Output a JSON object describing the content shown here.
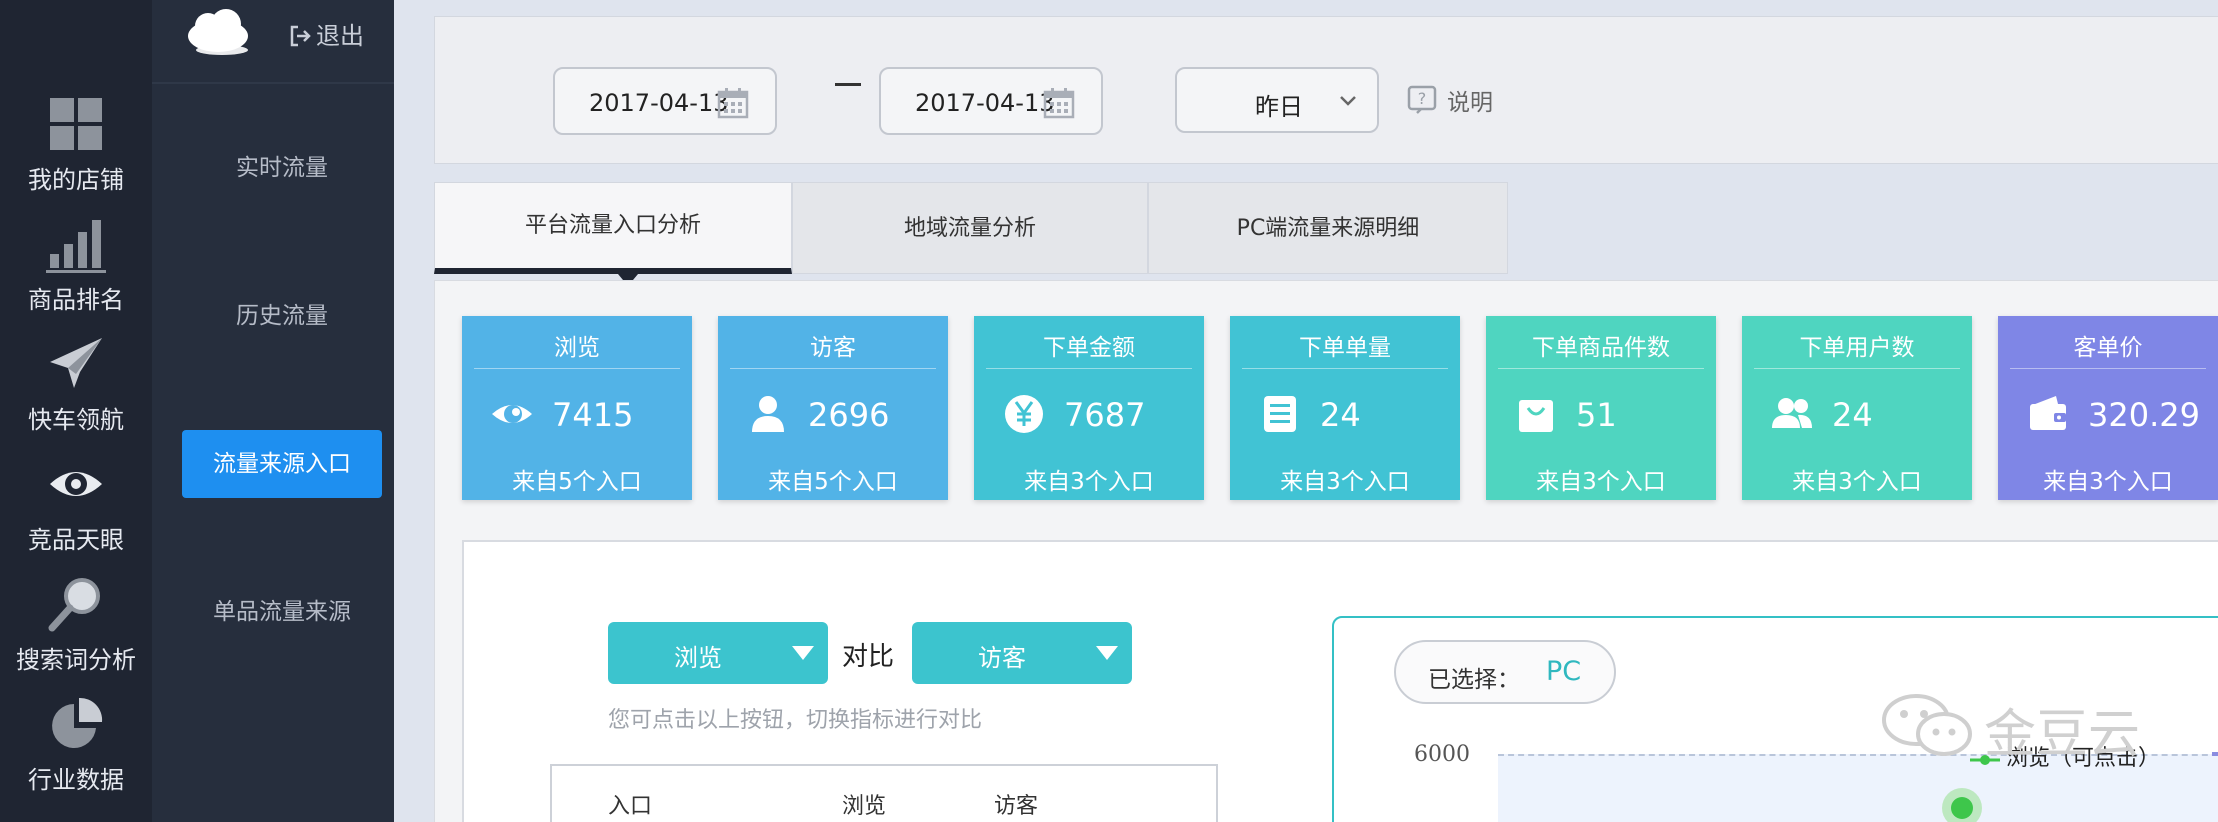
{
  "rail": {
    "items": [
      {
        "label": "我的店铺",
        "icon": "grid-icon"
      },
      {
        "label": "商品排名",
        "icon": "bar-chart-icon"
      },
      {
        "label": "快车领航",
        "icon": "paper-plane-icon"
      },
      {
        "label": "竞品天眼",
        "icon": "eye-icon"
      },
      {
        "label": "搜索词分析",
        "icon": "magnifier-icon"
      },
      {
        "label": "行业数据",
        "icon": "pie-chart-icon"
      }
    ]
  },
  "sidebar": {
    "logout_label": "退出",
    "items": [
      {
        "label": "实时流量",
        "active": false
      },
      {
        "label": "历史流量",
        "active": false
      },
      {
        "label": "流量来源入口",
        "active": true
      },
      {
        "label": "单品流量来源",
        "active": false
      }
    ]
  },
  "filters": {
    "start_date": "2017-04-13",
    "end_date": "2017-04-13",
    "period": "昨日",
    "help_label": "说明"
  },
  "tabs": [
    {
      "label": "平台流量入口分析",
      "active": true
    },
    {
      "label": "地域流量分析",
      "active": false
    },
    {
      "label": "PC端流量来源明细",
      "active": false
    }
  ],
  "cards": [
    {
      "title": "浏览",
      "value": "7415",
      "sub": "来自5个入口",
      "color": "#52b3e7",
      "icon": "eye-icon"
    },
    {
      "title": "访客",
      "value": "2696",
      "sub": "来自5个入口",
      "color": "#52b3e7",
      "icon": "user-icon"
    },
    {
      "title": "下单金额",
      "value": "7687",
      "sub": "来自3个入口",
      "color": "#41c3d4",
      "icon": "yen-icon"
    },
    {
      "title": "下单单量",
      "value": "24",
      "sub": "来自3个入口",
      "color": "#41c3d4",
      "icon": "list-icon"
    },
    {
      "title": "下单商品件数",
      "value": "51",
      "sub": "来自3个入口",
      "color": "#4fd5c0",
      "icon": "bag-icon"
    },
    {
      "title": "下单用户数",
      "value": "24",
      "sub": "来自3个入口",
      "color": "#4fd5c0",
      "icon": "users-icon"
    },
    {
      "title": "客单价",
      "value": "320.29",
      "sub": "来自3个入口",
      "color": "#7f86e6",
      "icon": "wallet-icon"
    }
  ],
  "compare": {
    "metric_a": "浏览",
    "vs_label": "对比",
    "metric_b": "访客",
    "hint": "您可点击以上按钮，切换指标进行对比"
  },
  "table": {
    "headers": [
      "入口",
      "浏览",
      "访客"
    ]
  },
  "chart": {
    "selected_label": "已选择：",
    "selected_value": "PC",
    "y_tick_top": "6000",
    "legend_label": "浏览（可点击）"
  },
  "watermark": {
    "text": "金豆云"
  }
}
